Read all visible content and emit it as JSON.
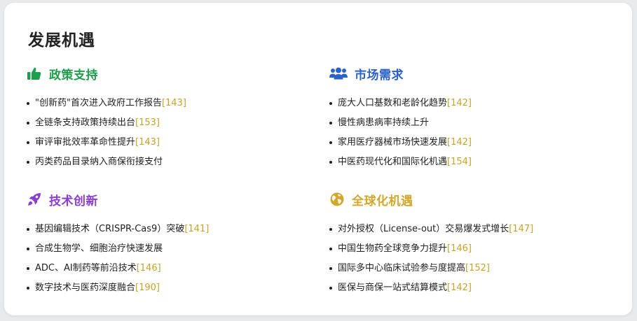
{
  "title": "发展机遇",
  "colors": {
    "green": "#1e9e4a",
    "blue": "#2b62c9",
    "purple": "#8a3fd1",
    "gold": "#d3a62c",
    "cite": "#c9a227"
  },
  "sections": [
    {
      "icon": "thumbs-up-icon",
      "title": "政策支持",
      "items": [
        {
          "text": "\"创新药\"首次进入政府工作报告",
          "cite": "[143]"
        },
        {
          "text": "全链条支持政策持续出台",
          "cite": "[153]"
        },
        {
          "text": "审评审批效率革命性提升",
          "cite": "[143]"
        },
        {
          "text": "丙类药品目录纳入商保衔接支付",
          "cite": ""
        }
      ]
    },
    {
      "icon": "users-icon",
      "title": "市场需求",
      "items": [
        {
          "text": "庞大人口基数和老龄化趋势",
          "cite": "[142]"
        },
        {
          "text": "慢性病患病率持续上升",
          "cite": ""
        },
        {
          "text": "家用医疗器械市场快速发展",
          "cite": "[142]"
        },
        {
          "text": "中医药现代化和国际化机遇",
          "cite": "[154]"
        }
      ]
    },
    {
      "icon": "rocket-icon",
      "title": "技术创新",
      "items": [
        {
          "text": "基因编辑技术（CRISPR-Cas9）突破",
          "cite": "[141]"
        },
        {
          "text": "合成生物学、细胞治疗快速发展",
          "cite": ""
        },
        {
          "text": "ADC、AI制药等前沿技术",
          "cite": "[146]"
        },
        {
          "text": "数字技术与医药深度融合",
          "cite": "[190]"
        }
      ]
    },
    {
      "icon": "globe-icon",
      "title": "全球化机遇",
      "items": [
        {
          "text": "对外授权（License-out）交易爆发式增长",
          "cite": "[147]"
        },
        {
          "text": "中国生物药全球竞争力提升",
          "cite": "[146]"
        },
        {
          "text": "国际多中心临床试验参与度提高",
          "cite": "[152]"
        },
        {
          "text": "医保与商保一站式结算模式",
          "cite": "[142]"
        }
      ]
    }
  ]
}
